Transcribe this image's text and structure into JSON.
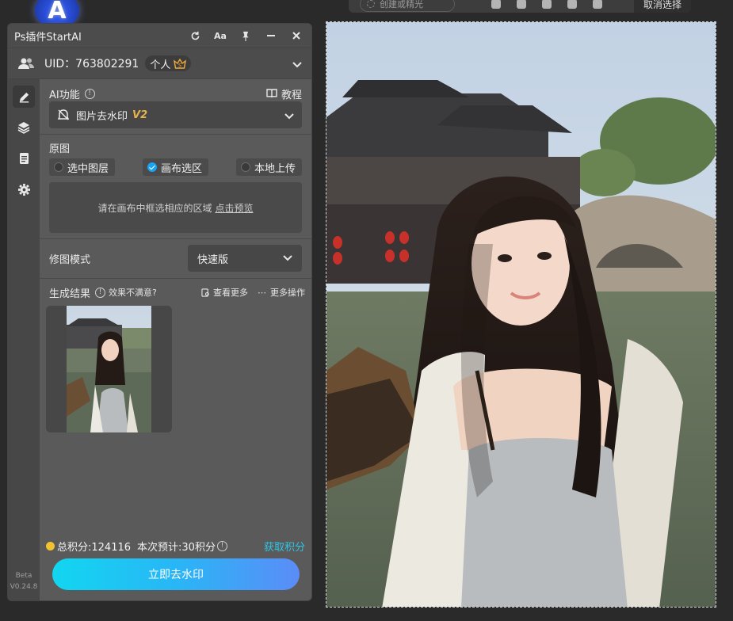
{
  "top_toolbar": {
    "selection_hint": "创建或精光",
    "cancel_label": "取消选择"
  },
  "logo": {
    "letter": "A"
  },
  "panel": {
    "title": "Ps插件StartAI",
    "title_buttons": {
      "font_size_label": "Aa"
    },
    "user": {
      "uid_label": "UID：763802291",
      "badge_label": "个人"
    },
    "ai_function": {
      "label": "AI功能",
      "help": "!",
      "tutorial_label": "教程",
      "selected_function": "图片去水印",
      "version_tag": "V2"
    },
    "source": {
      "label": "原图",
      "options": [
        {
          "label": "选中图层",
          "checked": false
        },
        {
          "label": "画布选区",
          "checked": true
        },
        {
          "label": "本地上传",
          "checked": false
        }
      ],
      "hint_text": "请在画布中框选相应的区域",
      "hint_link": "点击预览"
    },
    "repair_mode": {
      "label": "修图模式",
      "value": "快速版"
    },
    "results": {
      "label": "生成结果",
      "help": "!",
      "unsatisfied": "效果不满意?",
      "view_more": "查看更多",
      "more_actions": "更多操作"
    },
    "credits": {
      "total": "总积分:124116",
      "estimate": "本次预计:30积分",
      "help": "!",
      "get_link": "获取积分"
    },
    "primary_button": "立即去水印",
    "version": {
      "beta": "Beta",
      "number": "V0.24.8"
    }
  },
  "colors": {
    "accent_blue": "#1aa3f2",
    "v2_gold": "#e7b24a",
    "link_cyan": "#2ec5e6",
    "coin_yellow": "#f2c230"
  }
}
